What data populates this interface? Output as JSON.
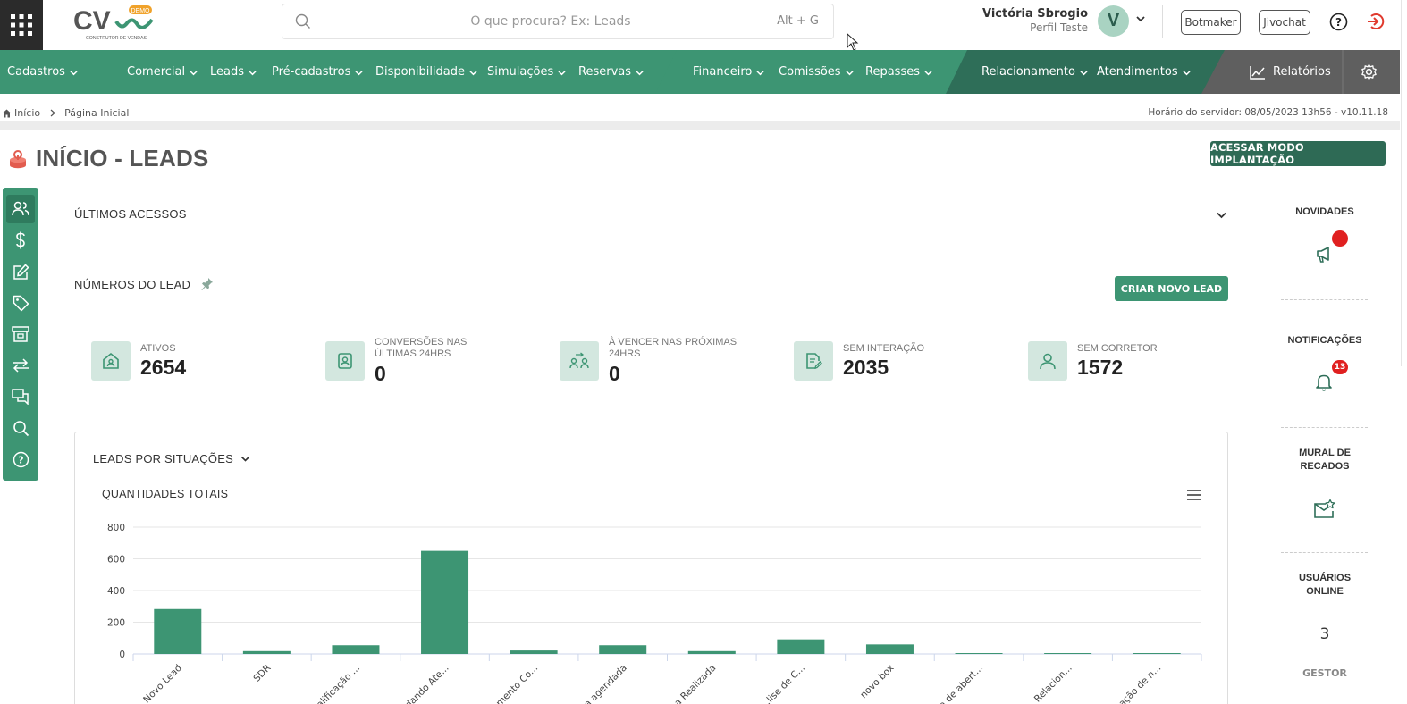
{
  "header": {
    "logo_text": "CV",
    "logo_badge": "DEMO",
    "logo_tagline": "CONSTRUTOR DE VENDAS",
    "search_placeholder": "O que procura? Ex: Leads",
    "search_shortcut": "Alt + G",
    "user_name": "Victória Sbrogio",
    "user_profile": "Perfil Teste",
    "avatar_letter": "V",
    "botmaker_label": "Botmaker",
    "jivochat_label": "Jivochat"
  },
  "nav": {
    "items": [
      {
        "label": "Cadastros"
      },
      {
        "label": "Comercial"
      },
      {
        "label": "Leads"
      },
      {
        "label": "Pré-cadastros"
      },
      {
        "label": "Disponibilidade"
      },
      {
        "label": "Simulações"
      },
      {
        "label": "Reservas"
      },
      {
        "label": "Financeiro"
      },
      {
        "label": "Comissões"
      },
      {
        "label": "Repasses"
      },
      {
        "label": "Relacionamento"
      },
      {
        "label": "Atendimentos"
      },
      {
        "label": "Relatórios"
      }
    ],
    "colors": {
      "light": "#44a37f",
      "mid": "#3d9573",
      "dark": "#2e6e58",
      "gray": "#5f5f5f"
    }
  },
  "breadcrumb": {
    "home": "Início",
    "current": "Página Inicial",
    "server_time": "Horário do servidor: 08/05/2023 13h56 - v10.11.18"
  },
  "page": {
    "title": "INÍCIO - LEADS",
    "implant_button": "ACESSAR MODO IMPLANTAÇÃO"
  },
  "sections": {
    "recent": "ÚLTIMOS ACESSOS",
    "numbers": "NÚMEROS DO LEAD",
    "new_lead_button": "CRIAR NOVO LEAD"
  },
  "stats": [
    {
      "label": "ATIVOS",
      "value": "2654",
      "icon": "house-icon"
    },
    {
      "label": "CONVERSÕES NAS ÚLTIMAS 24hrs",
      "value": "0",
      "icon": "user-badge-icon"
    },
    {
      "label": "À VENCER NAS PRÓXIMAS 24hrs",
      "value": "0",
      "icon": "users-exchange-icon"
    },
    {
      "label": "SEM INTERAÇÃO",
      "value": "2035",
      "icon": "document-edit-icon"
    },
    {
      "label": "SEM CORRETOR",
      "value": "1572",
      "icon": "user-icon"
    }
  ],
  "card": {
    "head": "LEADS POR SITUAÇÕES",
    "chart_title": "QUANTIDADES TOTAIS"
  },
  "chart_data": {
    "type": "bar",
    "title": "QUANTIDADES TOTAIS",
    "xlabel": "",
    "ylabel": "",
    "ylim": [
      0,
      800
    ],
    "yticks": [
      0,
      200,
      400,
      600,
      800
    ],
    "grid": true,
    "legend": "none",
    "bar_color": "#3d9573",
    "categories": [
      "Novo Lead",
      "SDR",
      "...alificação ...",
      "...dando Ate...",
      "...mento Co...",
      "...a agendada",
      "...a Realizada",
      "...lise de C...",
      "novo box",
      "...a de abert...",
      "Relacion...",
      "...ação de n..."
    ],
    "values": [
      283,
      18,
      55,
      650,
      22,
      55,
      18,
      92,
      60,
      3,
      2,
      4
    ]
  },
  "right_sidebar": {
    "news": "NOVIDADES",
    "notifications": "NOTIFICAÇÕES",
    "notif_count": "13",
    "wall": "MURAL DE RECADOS",
    "online": "USUÁRIOS ONLINE",
    "online_count": "3",
    "role": "GESTOR"
  }
}
